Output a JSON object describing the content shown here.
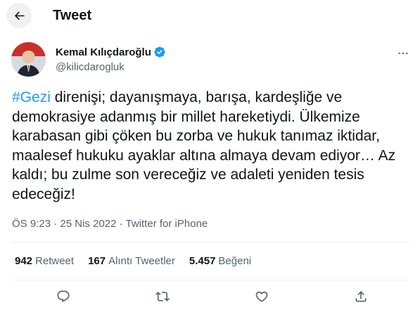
{
  "header": {
    "title": "Tweet",
    "back_icon": "arrow-left-icon"
  },
  "author": {
    "display_name": "Kemal Kılıçdaroğlu",
    "handle": "@kilicdarogluk",
    "verified_icon": "verified-badge-icon",
    "more_icon": "more-horizontal-icon"
  },
  "tweet": {
    "hashtag": "#Gezi",
    "body": " direnişi; dayanışmaya, barışa, kardeşliğe ve demokrasiye adanmış bir millet hareketiydi. Ülkemize karabasan gibi çöken bu zorba ve hukuk tanımaz iktidar, maalesef hukuku ayaklar altına almaya devam ediyor… Az kaldı; bu zulme son vereceğiz ve adaleti yeniden tesis edeceğiz!"
  },
  "meta": {
    "time": "ÖS 9:23",
    "separator": "·",
    "date": "25 Nis 2022",
    "source": "Twitter for iPhone"
  },
  "stats": [
    {
      "count": "942",
      "label": "Retweet"
    },
    {
      "count": "167",
      "label": "Alıntı Tweetler"
    },
    {
      "count": "5.457",
      "label": "Beğeni"
    }
  ],
  "actions": {
    "reply_icon": "reply-icon",
    "retweet_icon": "retweet-icon",
    "like_icon": "heart-icon",
    "share_icon": "share-icon"
  },
  "colors": {
    "accent": "#1d9bf0",
    "text": "#0f1419",
    "secondary": "#536471",
    "border": "#eff3f4"
  }
}
